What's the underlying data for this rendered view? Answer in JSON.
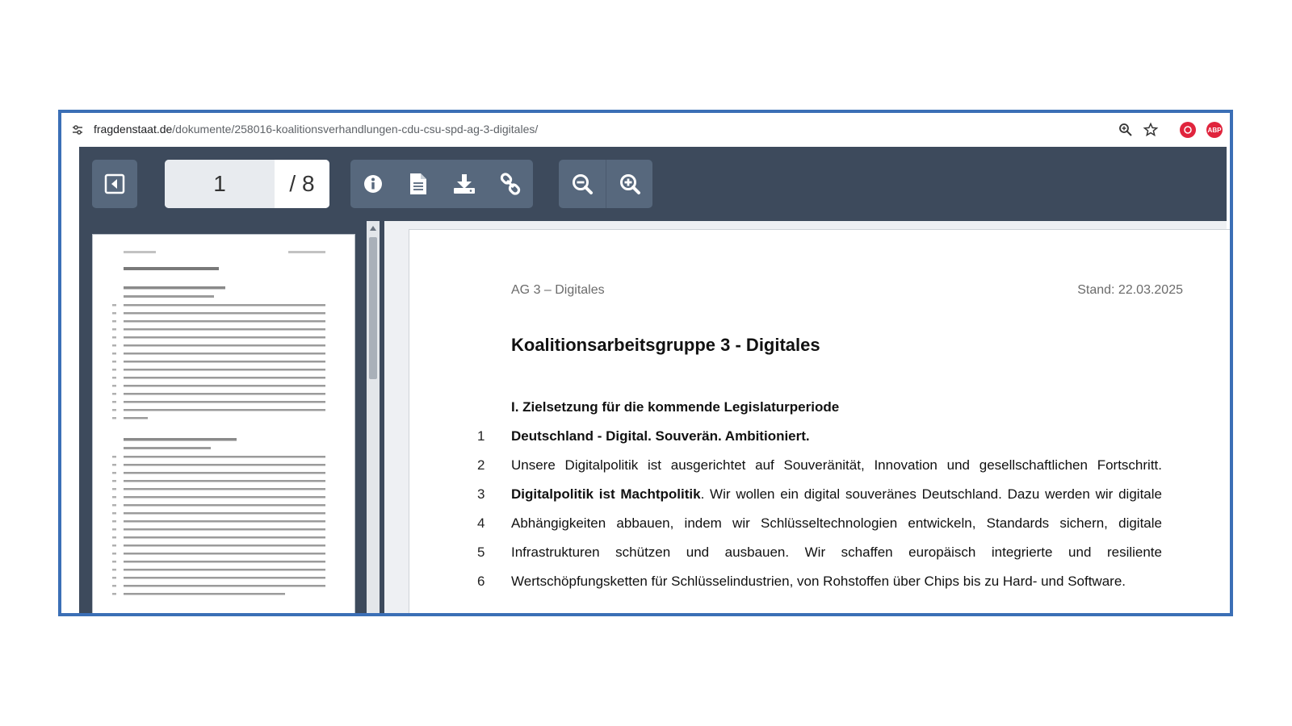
{
  "browser": {
    "url_domain": "fragdenstaat.de",
    "url_path": "/dokumente/258016-koalitionsverhandlungen-cdu-csu-spd-ag-3-digitales/",
    "icons": [
      "site-settings-icon",
      "zoom-icon",
      "bookmark-star-icon",
      "extension-icon",
      "adblock-icon"
    ],
    "adblock_label": "ABP"
  },
  "toolbar": {
    "current_page": "1",
    "total_pages": "/ 8"
  },
  "colors": {
    "toolbar": "#3d4a5c",
    "button": "#57687d",
    "frame_border": "#3b6fb6"
  },
  "document": {
    "header_left": "AG 3 – Digitales",
    "header_right": "Stand: 22.03.2025",
    "title": "Koalitionsarbeitsgruppe 3 - Digitales",
    "section": "I. Zielsetzung für die kommende Legislaturperiode",
    "lines": [
      {
        "num": "1",
        "bold": "Deutschland - Digital. Souverän. Ambitioniert.",
        "text": ""
      },
      {
        "num": "2",
        "bold": "",
        "text": "Unsere Digitalpolitik ist ausgerichtet auf Souveränität, Innovation und gesellschaftlichen Fortschritt."
      },
      {
        "num": "3",
        "bold": "Digitalpolitik ist Machtpolitik",
        "text": ". Wir wollen ein digital souveränes Deutschland. Dazu werden wir digitale"
      },
      {
        "num": "4",
        "bold": "",
        "text": "Abhängigkeiten abbauen, indem wir Schlüsseltechnologien entwickeln, Standards sichern, digitale"
      },
      {
        "num": "5",
        "bold": "",
        "text": "Infrastrukturen schützen und ausbauen. Wir schaffen europäisch integrierte und resiliente"
      },
      {
        "num": "6",
        "bold": "",
        "text": "Wertschöpfungsketten für Schlüsselindustrien, von Rohstoffen über Chips bis zu Hard- und Software."
      }
    ]
  }
}
